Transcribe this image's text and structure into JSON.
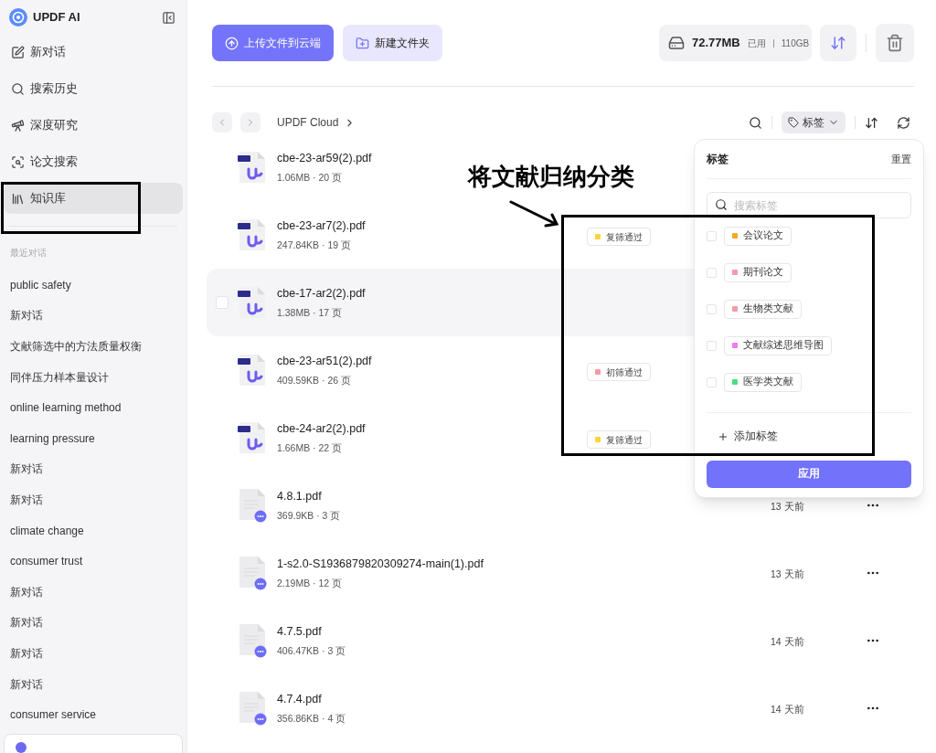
{
  "sidebar": {
    "brand": "UPDF AI",
    "nav": [
      {
        "kind": "new-chat",
        "label": "新对话",
        "selected": false
      },
      {
        "kind": "search",
        "label": "搜索历史",
        "selected": false
      },
      {
        "kind": "research",
        "label": "深度研究",
        "selected": false
      },
      {
        "kind": "paper",
        "label": "论文搜索",
        "selected": false
      },
      {
        "kind": "library",
        "label": "知识库",
        "selected": true
      }
    ],
    "recent_header": "最近对话",
    "recent": [
      "public safety",
      "新对话",
      "文献筛选中的方法质量权衡",
      "同伴压力样本量设计",
      "online learning method",
      "learning pressure",
      "新对话",
      "新对话",
      "climate change",
      "consumer trust",
      "新对话",
      "新对话",
      "新对话",
      "新对话",
      "consumer service"
    ]
  },
  "header": {
    "upload": "上传文件到云端",
    "new_folder": "新建文件夹",
    "storage": {
      "used": "72.77MB",
      "used_label": "已用",
      "total": "110GB"
    }
  },
  "toolbar": {
    "breadcrumb": "UPDF Cloud",
    "tag_filter": "标签"
  },
  "files": [
    {
      "kind": "updf",
      "name": "cbe-23-ar59(2).pdf",
      "meta": "1.06MB · 20 页",
      "hovered": false
    },
    {
      "kind": "updf",
      "name": "cbe-23-ar7(2).pdf",
      "meta": "247.84KB · 19 页",
      "hovered": false,
      "tag": {
        "label": "复筛通过",
        "color": "#fcd53f"
      }
    },
    {
      "kind": "updf",
      "name": "cbe-17-ar2(2).pdf",
      "meta": "1.38MB · 17 页",
      "hovered": true
    },
    {
      "kind": "updf",
      "name": "cbe-23-ar51(2).pdf",
      "meta": "409.59KB · 26 页",
      "hovered": false,
      "tag": {
        "label": "初筛通过",
        "color": "#f49aa8"
      }
    },
    {
      "kind": "updf",
      "name": "cbe-24-ar2(2).pdf",
      "meta": "1.66MB · 22 页",
      "hovered": false,
      "tag": {
        "label": "复筛通过",
        "color": "#fcd53f"
      }
    },
    {
      "kind": "doc",
      "name": "4.8.1.pdf",
      "meta": "369.9KB · 3 页",
      "hovered": false,
      "date": "13 天前"
    },
    {
      "kind": "doc",
      "name": "1-s2.0-S1936879820309274-main(1).pdf",
      "meta": "2.19MB · 12 页",
      "hovered": false,
      "date": "13 天前"
    },
    {
      "kind": "doc",
      "name": "4.7.5.pdf",
      "meta": "406.47KB · 3 页",
      "hovered": false,
      "date": "14 天前"
    },
    {
      "kind": "doc",
      "name": "4.7.4.pdf",
      "meta": "356.86KB · 4 页",
      "hovered": false,
      "date": "14 天前"
    }
  ],
  "tag_popup": {
    "title": "标签",
    "reset": "重置",
    "search_placeholder": "搜索标签",
    "tags": [
      {
        "label": "会议论文",
        "color": "#f5a623",
        "checked": false
      },
      {
        "label": "期刊论文",
        "color": "#f49aa8",
        "checked": false
      },
      {
        "label": "生物类文献",
        "color": "#f49aa8",
        "checked": false
      },
      {
        "label": "文献综述思维导图",
        "color": "#f07cf0",
        "checked": false
      },
      {
        "label": "医学类文献",
        "color": "#4ade80",
        "checked": false
      }
    ],
    "add": "添加标签",
    "apply": "应用"
  },
  "annotation": {
    "text": "将文献归纳分类"
  }
}
